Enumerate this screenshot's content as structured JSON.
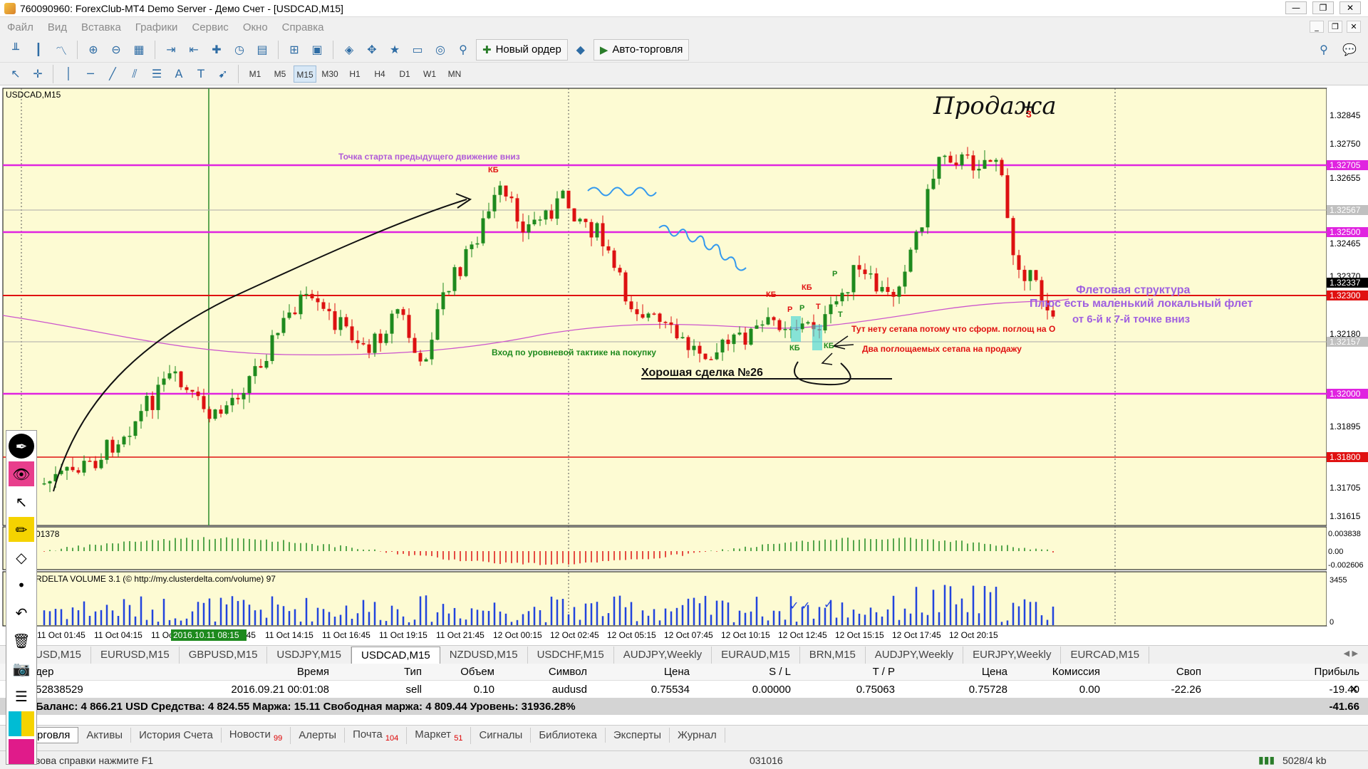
{
  "window": {
    "title": "760090960: ForexClub-MT4 Demo Server - Демо Счет - [USDCAD,M15]",
    "buttons": [
      "—",
      "❐",
      "✕"
    ]
  },
  "menu": [
    "Файл",
    "Вид",
    "Вставка",
    "Графики",
    "Сервис",
    "Окно",
    "Справка"
  ],
  "toolbar": {
    "new_order": "Новый ордер",
    "autotrading": "Авто-торговля"
  },
  "timeframes": [
    "M1",
    "M5",
    "M15",
    "M30",
    "H1",
    "H4",
    "D1",
    "W1",
    "MN"
  ],
  "active_timeframe": "M15",
  "chart": {
    "symbol_label": "USDCAD,M15",
    "indicator_value": "01378",
    "volume_label": "RDELTA VOLUME 3.1 (© http://my.clusterdelta.com/volume) 97",
    "price_ticks": [
      "1.32845",
      "1.32750",
      "1.32655",
      "1.32465",
      "1.32370",
      "1.32180",
      "1.31895",
      "1.31705",
      "1.31615"
    ],
    "tagged_prices": {
      "p1": "1.32705",
      "p2": "1.32567",
      "p3": "1.32500",
      "p4": "1.32337",
      "p5": "1.32300",
      "p6": "1.32157",
      "p7": "1.32000",
      "p8": "1.31800"
    },
    "osc_ticks": [
      "0.003838",
      "0.00",
      "-0.002606"
    ],
    "vol_ticks": [
      "3455",
      "0"
    ],
    "time_labels": [
      "016",
      "11 Oct 01:45",
      "11 Oct 04:15",
      "11 Oct 09:15",
      "11 Oct 11:45",
      "11 Oct 14:15",
      "11 Oct 16:45",
      "11 Oct 19:15",
      "11 Oct 21:45",
      "12 Oct 00:15",
      "12 Oct 02:45",
      "12 Oct 05:15",
      "12 Oct 07:45",
      "12 Oct 10:15",
      "12 Oct 12:45",
      "12 Oct 15:15",
      "12 Oct 17:45",
      "12 Oct 20:15"
    ],
    "time_cursor": "2016.10.11 08:15",
    "annotations": {
      "start_point": "Точка старта предыдущего движение вниз",
      "flat_structure": "Флетовая структура",
      "local_flat": "Плюс есть маленький локальный флет",
      "points": "от 6-й к 7-й точке вниз",
      "no_setup": "Тут нету сетапа потому что сформ. поглощ на О",
      "two_setups": "Два поглощаемых сетапа на продажу",
      "entry": "Вход по уровневой тактике на покупку",
      "good_trade": "Хорошая сделка №26",
      "handwritten": "Продажа",
      "num3": "3",
      "kb1": "КБ",
      "kb2": "КБ",
      "kb3": "КБ",
      "kb4": "КБ",
      "kb5": "КБ",
      "pa": "Р",
      "pb": "Р",
      "pc": "Р",
      "ta": "Т",
      "tb": "Т"
    },
    "colors": {
      "bg": "#fdfbd3",
      "bull": "#1e8a1e",
      "bear": "#dd1111",
      "magenta": "#e024e0",
      "red_line": "#e01111",
      "ma": "#cc55cc",
      "volume": "#2244dd"
    }
  },
  "symbol_tabs": [
    "USD,M15",
    "EURUSD,M15",
    "GBPUSD,M15",
    "USDJPY,M15",
    "USDCAD,M15",
    "NZDUSD,M15",
    "USDCHF,M15",
    "AUDJPY,Weekly",
    "EURAUD,M15",
    "BRN,M15",
    "AUDJPY,Weekly",
    "EURJPY,Weekly",
    "EURCAD,M15"
  ],
  "active_symbol_tab": "USDCAD,M15",
  "terminal": {
    "headers": [
      "дер",
      "Время",
      "Тип",
      "Объем",
      "Символ",
      "Цена",
      "S / L",
      "T / P",
      "Цена",
      "Комиссия",
      "Своп",
      "Прибыль"
    ],
    "row": [
      "52838529",
      "2016.09.21 00:01:08",
      "sell",
      "0.10",
      "audusd",
      "0.75534",
      "0.00000",
      "0.75063",
      "0.75728",
      "0.00",
      "-22.26",
      "-19.40"
    ],
    "balance": "Баланс: 4 866.21 USD  Средства: 4 824.55  Маржа: 15.11  Свободная маржа: 4 809.44  Уровень: 31936.28%",
    "total_profit": "-41.66"
  },
  "bottom_tabs": [
    {
      "label": "рговля",
      "count": ""
    },
    {
      "label": "Активы",
      "count": ""
    },
    {
      "label": "История Счета",
      "count": ""
    },
    {
      "label": "Новости",
      "count": "99"
    },
    {
      "label": "Алерты",
      "count": ""
    },
    {
      "label": "Почта",
      "count": "104"
    },
    {
      "label": "Маркет",
      "count": "51"
    },
    {
      "label": "Сигналы",
      "count": ""
    },
    {
      "label": "Библиотека",
      "count": ""
    },
    {
      "label": "Эксперты",
      "count": ""
    },
    {
      "label": "Журнал",
      "count": ""
    }
  ],
  "status": {
    "help": "зова справки нажмите F1",
    "date": "031016",
    "traffic": "5028/4 kb"
  }
}
